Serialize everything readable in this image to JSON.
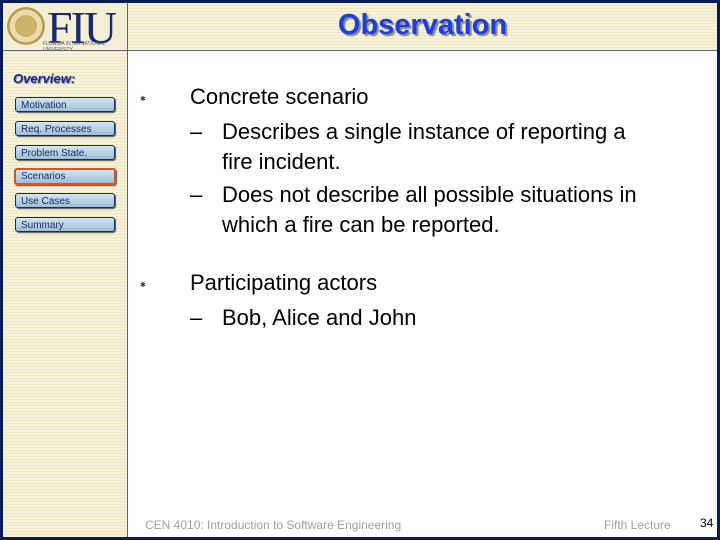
{
  "logo": {
    "text": "FIU",
    "subtitle": "Florida International University"
  },
  "title": "Observation",
  "sidebar": {
    "heading": "Overview:",
    "items": [
      {
        "label": "Motivation",
        "active": false
      },
      {
        "label": "Req. Processes",
        "active": false
      },
      {
        "label": "Problem State.",
        "active": false
      },
      {
        "label": "Scenarios",
        "active": true
      },
      {
        "label": "Use Cases",
        "active": false
      },
      {
        "label": "Summary",
        "active": false
      }
    ]
  },
  "bullets": [
    {
      "text": "Concrete scenario",
      "subs": [
        {
          "lines": [
            "Describes a single instance of reporting a",
            "fire incident."
          ]
        },
        {
          "lines": [
            "Does not describe all possible situations in",
            "which a fire can be reported."
          ]
        }
      ]
    },
    {
      "text": "Participating actors",
      "subs": [
        {
          "lines": [
            "Bob, Alice and  John"
          ]
        }
      ]
    }
  ],
  "footer": {
    "course": "CEN 4010: Introduction to Software Engineering",
    "lecture": "Fifth Lecture",
    "page": "34"
  },
  "colors": {
    "border": "#0a1a5c",
    "title": "#1f3fd8",
    "active_outline": "#e05020"
  }
}
